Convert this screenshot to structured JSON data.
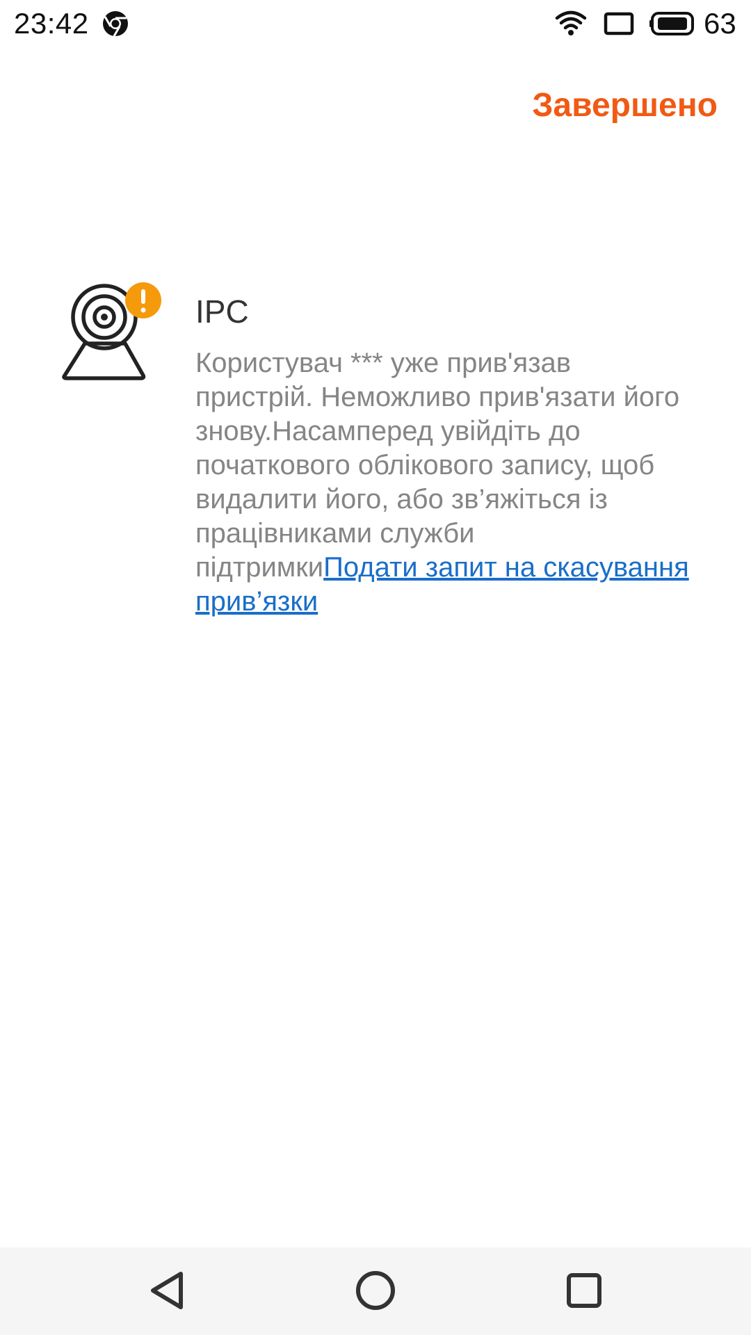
{
  "status_bar": {
    "time": "23:42",
    "battery_level": "63",
    "icons": {
      "browser": "chrome-icon",
      "wifi": "wifi-icon",
      "screen": "screen-icon",
      "battery": "battery-icon"
    }
  },
  "header": {
    "done_label": "Завершено",
    "accent_color": "#f05a14"
  },
  "device": {
    "title": "IPC",
    "icon": "camera-icon",
    "warning_icon": "warning-badge-icon",
    "message": "Користувач *** уже прив'язав пристрій. Неможливо прив'язати його знову.Насамперед увійдіть до початкового облікового запису, щоб видалити його, або зв’яжіться із працівниками служби підтримки",
    "link_text": "Подати запит на скасування прив’язки",
    "link_color": "#1a6ec8"
  },
  "nav_bar": {
    "back_icon": "back-icon",
    "home_icon": "home-icon",
    "recent_icon": "recent-apps-icon"
  }
}
